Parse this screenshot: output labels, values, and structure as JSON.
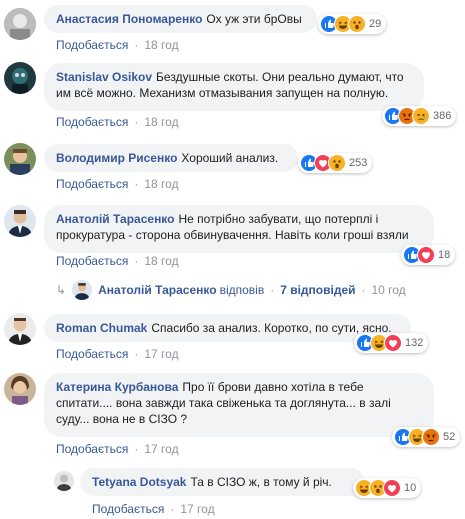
{
  "labels": {
    "like": "Подобається",
    "replied": "відповів",
    "replies_time": "10 год"
  },
  "comments": [
    {
      "author": "Анастасия Пономаренко",
      "text": "Ох уж эти брОвы",
      "time": "18 год",
      "reactions_count": "29",
      "reactions": [
        "like-icon",
        "haha-icon",
        "wow-icon"
      ]
    },
    {
      "author": "Stanislav Osikov",
      "text": "Бездушные скоты. Они реально думают, что им всё можно. Механизм отмазывания запущен на полную.",
      "time": "18 год",
      "reactions_count": "386",
      "reactions": [
        "like-icon",
        "angry-icon",
        "sad-icon"
      ]
    },
    {
      "author": "Володимир Рисенко",
      "text": "Хороший анализ.",
      "time": "18 год",
      "reactions_count": "253",
      "reactions": [
        "like-icon",
        "love-icon",
        "wow-icon"
      ]
    },
    {
      "author": "Анатолій Тарасенко",
      "text": "Не потрібно забувати, що потерплі і прокуратура - сторона обвинувачення. Навіть коли гроші взяли",
      "time": "18 год",
      "reactions_count": "18",
      "reactions": [
        "like-icon",
        "love-icon"
      ]
    },
    {
      "author": "Roman Chumak",
      "text": "Спасибо за анализ. Коротко, по сути, ясно.",
      "time": "17 год",
      "reactions_count": "132",
      "reactions": [
        "like-icon",
        "haha-icon",
        "love-icon"
      ]
    },
    {
      "author": "Катерина Курбанова",
      "text": "Про її брови давно хотіла в тебе спитати.... вона завжди така свіженька та доглянута... в залі суду... вона не в СІЗО ?",
      "time": "17 год",
      "reactions_count": "52",
      "reactions": [
        "like-icon",
        "haha-icon",
        "angry-icon"
      ]
    },
    {
      "author": "Tetyana Dotsyak",
      "text": "Та в СІЗО ж, в тому й річ.",
      "time": "17 год",
      "reactions_count": "10",
      "reactions": [
        "haha-icon",
        "wow-icon",
        "love-icon"
      ]
    }
  ],
  "reply_summary": {
    "author": "Анатолій Тарасенко",
    "count_text": "7 відповідей"
  },
  "colors": {
    "link": "#385898",
    "bubble": "#f2f3f5",
    "meta": "#90949c"
  }
}
